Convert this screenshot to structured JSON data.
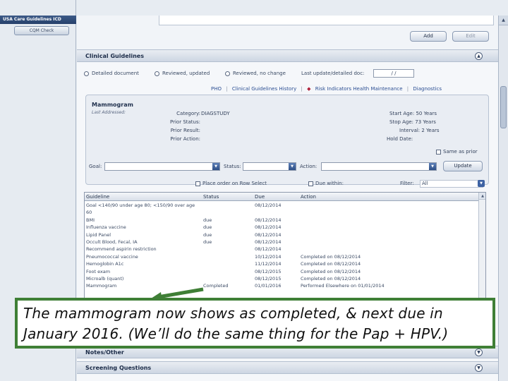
{
  "sidebar": {
    "title": "USA Care Guidelines ICD",
    "cqm_button": "CQM Check"
  },
  "toolbar": {
    "add_label": "Add",
    "edit_label": "Edit"
  },
  "clinical": {
    "section_title": "Clinical Guidelines",
    "radio_detailed": "Detailed document",
    "radio_reviewed_updated": "Reviewed, updated",
    "radio_reviewed_nochange": "Reviewed, no change",
    "last_update_label": "Last update/detailed doc:",
    "last_update_value": "/ /",
    "links": {
      "pho": "PHO",
      "history": "Clinical Guidelines History",
      "risk": "Risk Indicators Health Maintenance",
      "diagnostics": "Diagnostics"
    }
  },
  "panel": {
    "title": "Mammogram",
    "subtitle": "Last Addressed:",
    "category_label": "Category:",
    "category_value": "DIAGSTUDY",
    "prior_status_label": "Prior Status:",
    "prior_result_label": "Prior Result:",
    "prior_action_label": "Prior Action:",
    "start_age": "Start Age: 50 Years",
    "stop_age": "Stop Age: 73 Years",
    "interval": "Interval: 2 Years",
    "hold_date": "Hold Date:",
    "same_as_prior": "Same as prior",
    "goal_label": "Goal:",
    "status_label": "Status:",
    "action_label": "Action:",
    "update_button": "Update"
  },
  "order_row": {
    "place_order": "Place order on Row Select",
    "due_within": "Due within:",
    "filter_label": "Filter:",
    "filter_value": "All"
  },
  "grid": {
    "headers": [
      "Guideline",
      "Status",
      "Due",
      "Action"
    ],
    "rows": [
      [
        "Goal <140/90 under age 80; <150/90 over age",
        "",
        "08/12/2014",
        ""
      ],
      [
        "60",
        "",
        "",
        ""
      ],
      [
        "BMI",
        "due",
        "08/12/2014",
        ""
      ],
      [
        "Influenza vaccine",
        "due",
        "08/12/2014",
        ""
      ],
      [
        "Lipid Panel",
        "due",
        "08/12/2014",
        ""
      ],
      [
        "Occult Blood, Fecal, IA",
        "due",
        "08/12/2014",
        ""
      ],
      [
        "Recommend aspirin restriction",
        "",
        "08/12/2014",
        ""
      ],
      [
        "Pneumococcal vaccine",
        "",
        "10/12/2014",
        "Completed on 08/12/2014"
      ],
      [
        "Hemoglobin A1c",
        "",
        "11/12/2014",
        "Completed on 08/12/2014"
      ],
      [
        "Foot exam",
        "",
        "08/12/2015",
        "Completed on 08/12/2014"
      ],
      [
        "Microalb (quant)",
        "",
        "08/12/2015",
        "Completed on 08/12/2014"
      ],
      [
        "Mammogram",
        "Completed",
        "01/01/2016",
        "Performed Elsewhere on 01/01/2014"
      ]
    ]
  },
  "notes_bar": {
    "title": "Notes/Other"
  },
  "screening_bar": {
    "title": "Screening Questions"
  },
  "callout": {
    "line1": "The mammogram now shows as completed, & next due in",
    "line2": "January 2016.  (We’ll do the same thing for the Pap + HPV.)"
  },
  "colors": {
    "callout_border": "#3f7f36",
    "arrow": "#3f7f36",
    "link": "#2c4f93"
  }
}
